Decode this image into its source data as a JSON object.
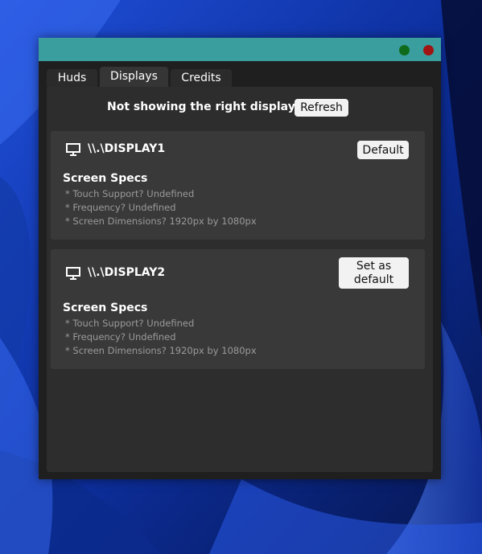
{
  "colors": {
    "titlebar": "#3a9e9e",
    "window_bg": "#1f1f1f",
    "panel_bg": "#2d2d2d",
    "card_bg": "#393939",
    "button_bg": "#f2f2f2",
    "green_dot": "#0f6b1c",
    "red_dot": "#a11414",
    "spec_text": "#9a9a9a"
  },
  "tabs": {
    "huds": "Huds",
    "displays": "Displays",
    "credits": "Credits",
    "active": "Displays"
  },
  "notice": {
    "text": "Not showing the right displays?",
    "refresh_label": "Refresh"
  },
  "displays": [
    {
      "icon": "monitor-icon",
      "name": "\\\\.\\DISPLAY1",
      "button_label": "Default",
      "specs_title": "Screen Specs",
      "specs": [
        "* Touch Support? Undefined",
        "* Frequency? Undefined",
        "* Screen Dimensions? 1920px by 1080px"
      ]
    },
    {
      "icon": "monitor-icon",
      "name": "\\\\.\\DISPLAY2",
      "button_label_line1": "Set as",
      "button_label_line2": "default",
      "specs_title": "Screen Specs",
      "specs": [
        "* Touch Support? Undefined",
        "* Frequency? Undefined",
        "* Screen Dimensions? 1920px by 1080px"
      ]
    }
  ]
}
